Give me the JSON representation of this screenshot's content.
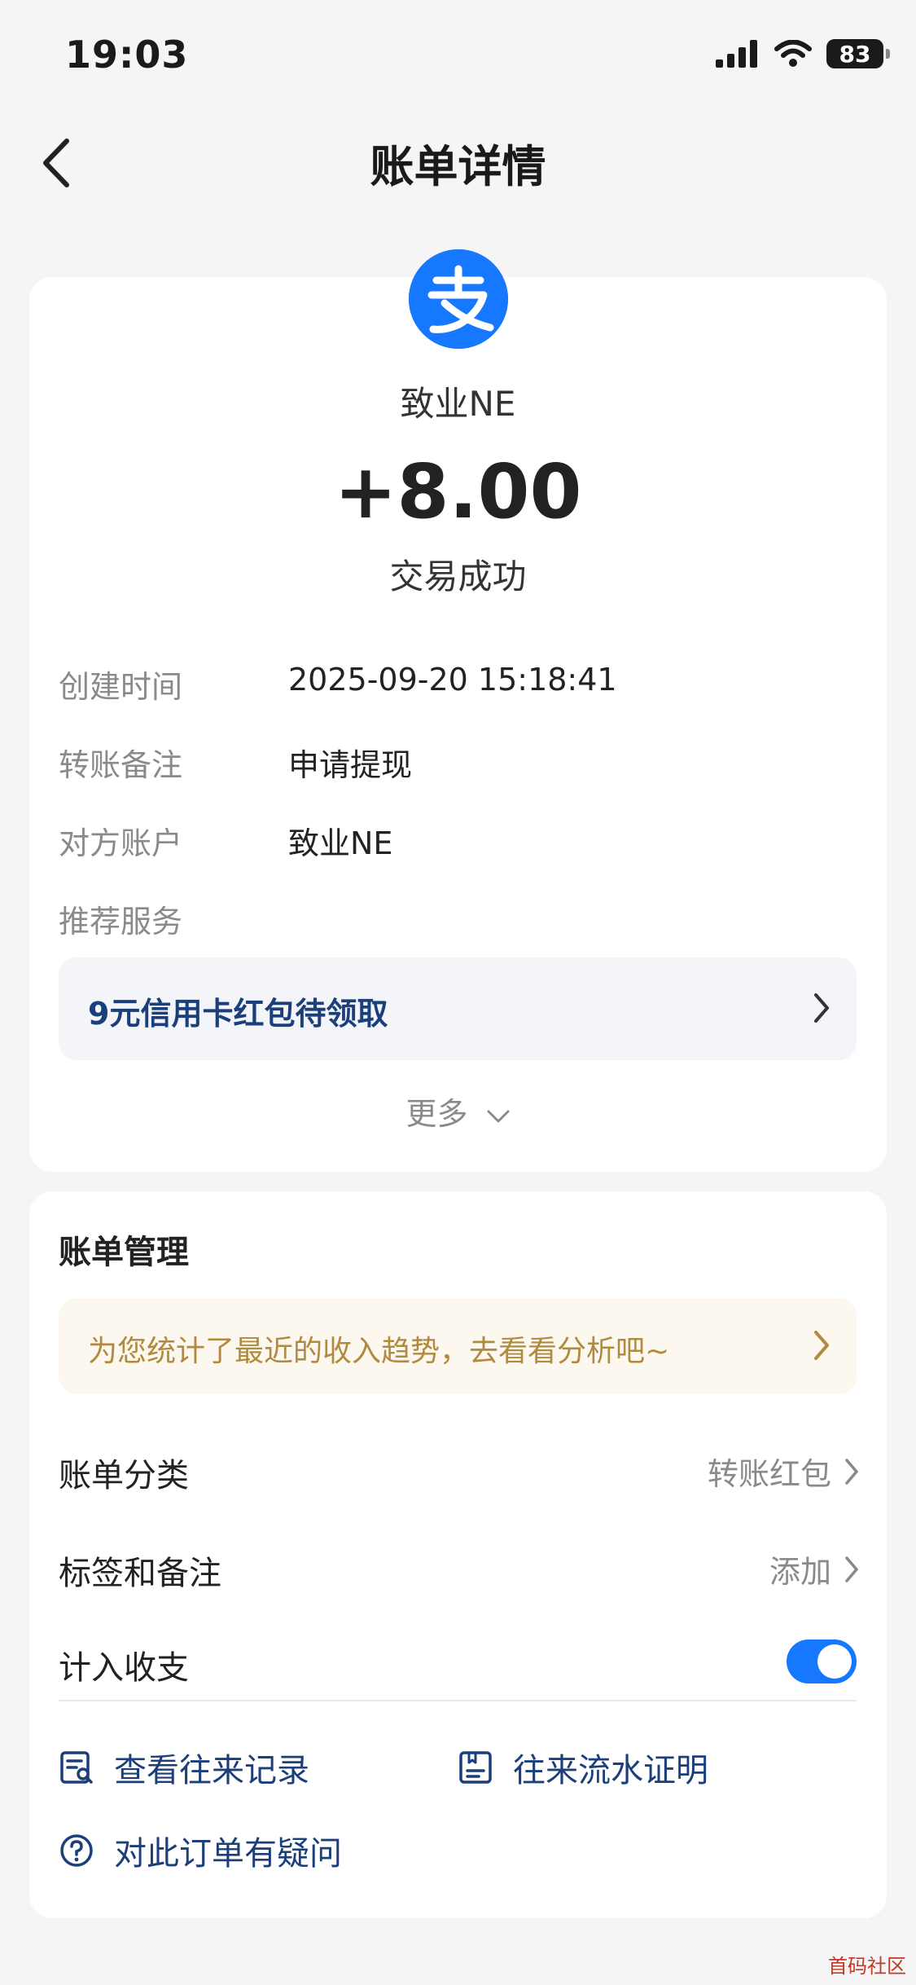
{
  "status_bar": {
    "time": "19:03",
    "battery": "83"
  },
  "nav": {
    "title": "账单详情"
  },
  "transaction": {
    "payee": "致业NE",
    "amount": "+8.00",
    "status": "交易成功"
  },
  "details": [
    {
      "label": "创建时间",
      "value": "2025-09-20 15:18:41"
    },
    {
      "label": "转账备注",
      "value": "申请提现"
    },
    {
      "label": "对方账户",
      "value": "致业NE"
    },
    {
      "label": "推荐服务",
      "value": ""
    }
  ],
  "promo": {
    "text": "9元信用卡红包待领取"
  },
  "more_label": "更多",
  "management": {
    "title": "账单管理",
    "tip": "为您统计了最近的收入趋势，去看看分析吧~",
    "category": {
      "label": "账单分类",
      "value": "转账红包"
    },
    "tags": {
      "label": "标签和备注",
      "value": "添加"
    },
    "count_in": {
      "label": "计入收支",
      "enabled": true
    }
  },
  "links": {
    "records": "查看往来记录",
    "proof": "往来流水证明",
    "question": "对此订单有疑问"
  },
  "watermark": "首码社区",
  "colors": {
    "accent": "#1677ff",
    "promo_text": "#1b3f7a",
    "tip_text": "#b08a3e"
  }
}
